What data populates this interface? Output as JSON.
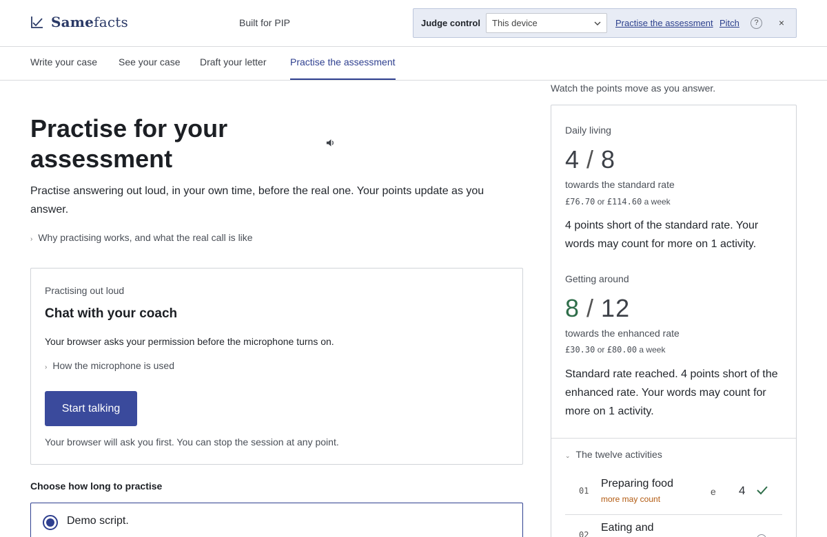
{
  "brand": {
    "name_part1": "Same",
    "name_part2": "facts"
  },
  "header": {
    "tagline": "Built for PIP",
    "judge": {
      "label": "Judge control",
      "device_selected": "This device",
      "link_practise": "Practise the assessment",
      "link_pitch": "Pitch",
      "help": "?",
      "close": "×"
    }
  },
  "tabs": [
    {
      "label": "Write your case",
      "active": false
    },
    {
      "label": "See your case",
      "active": false
    },
    {
      "label": "Draft your letter",
      "active": false
    },
    {
      "label": "Practise the assessment",
      "active": true
    }
  ],
  "main": {
    "title": "Practise for your assessment",
    "intro": "Practise answering out loud, in your own time, before the real one. Your points update as you answer.",
    "why_link": "Why practising works, and what the real call is like",
    "coach": {
      "kicker": "Practising out loud",
      "title": "Chat with your coach",
      "permission": "Your browser asks your permission before the microphone turns on.",
      "how_link": "How the microphone is used",
      "start_button": "Start talking",
      "note": "Your browser will ask you first. You can stop the session at any point."
    },
    "choose_label": "Choose how long to practise",
    "options": [
      {
        "label": "Demo script.",
        "selected": true
      }
    ]
  },
  "panel": {
    "watch_note": "Watch the points move as you answer.",
    "daily": {
      "label": "Daily living",
      "points": "4",
      "slash": "/",
      "max": "8",
      "towards": "towards the standard rate",
      "rate_low": "£76.70",
      "rate_or": "or",
      "rate_high": "£114.60",
      "rate_suffix": "a week",
      "status": "4 points short of the standard rate. Your words may count for more on 1 activity."
    },
    "mobility": {
      "label": "Getting around",
      "points": "8",
      "slash": "/",
      "max": "12",
      "towards": "towards the enhanced rate",
      "rate_low": "£30.30",
      "rate_or": "or",
      "rate_high": "£80.00",
      "rate_suffix": "a week",
      "status": "Standard rate reached. 4 points short of the enhanced rate. Your words may count for more on 1 activity."
    },
    "activities_label": "The twelve activities",
    "activities": [
      {
        "num": "01",
        "name": "Preparing food",
        "more": "more may count",
        "marker": "e",
        "points": "4",
        "state": "check-icon"
      },
      {
        "num": "02",
        "name": "Eating and",
        "more": "",
        "marker": "",
        "points": "",
        "state": "empty-circle"
      }
    ]
  },
  "colors": {
    "accent": "#2e3f8f",
    "button": "#3a4a9c",
    "green": "#2f6e4a",
    "warning": "#b25a10"
  }
}
